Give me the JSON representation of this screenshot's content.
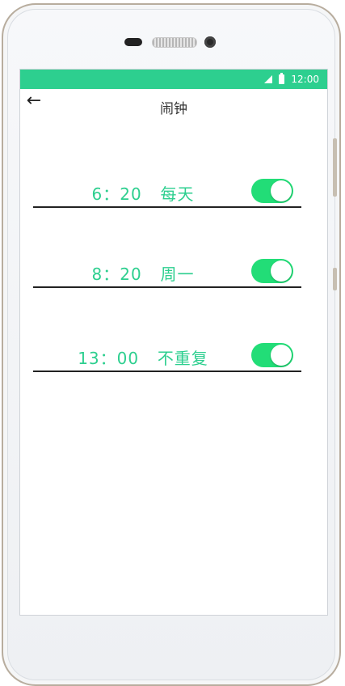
{
  "device": {
    "status_bar": {
      "time": "12:00",
      "signal_icon": "signal-icon",
      "battery_icon": "battery-icon"
    }
  },
  "header": {
    "back_icon": "arrow-left-icon",
    "title": "闹钟"
  },
  "alarms": [
    {
      "time": "6：20",
      "repeat": "每天",
      "enabled": true
    },
    {
      "time": "8：20",
      "repeat": "周一",
      "enabled": true
    },
    {
      "time": "13：00",
      "repeat": "不重复",
      "enabled": true
    }
  ],
  "colors": {
    "accent": "#2dcf8f",
    "toggle_on": "#22dd77",
    "divider": "#222222"
  }
}
